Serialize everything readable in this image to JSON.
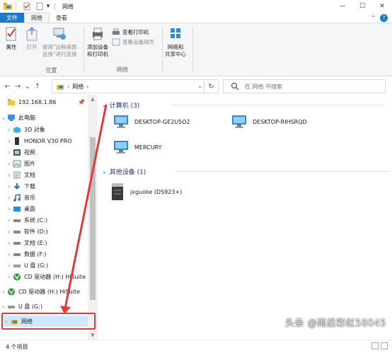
{
  "window": {
    "title": "网络",
    "controls": {
      "minimize": "—",
      "maximize": "☐",
      "close": "✕"
    }
  },
  "ribbon": {
    "tabs": [
      "文件",
      "网络",
      "查看"
    ],
    "groups": {
      "location": {
        "label": "位置",
        "buttons": [
          "属性",
          "打开",
          "使用\"远程桌面",
          "连接\"进行连接"
        ]
      },
      "network": {
        "label": "网络",
        "add_device": [
          "添加设备",
          "和打印机"
        ],
        "view_printers": "查看打印机",
        "view_device_page": "查看设备网页",
        "network_center": [
          "网络和",
          "共享中心"
        ]
      }
    }
  },
  "address": {
    "path": "网络",
    "search_placeholder": "在 网络 中搜索"
  },
  "nav": {
    "items": [
      {
        "label": "192.168.1.86",
        "icon": "folder-icon",
        "pinned": true
      },
      {
        "label": "此电脑",
        "icon": "computer-icon",
        "expanded": true
      },
      {
        "label": "3D 对象",
        "icon": "3d-objects-icon"
      },
      {
        "label": "HONOR V30 PRO",
        "icon": "phone-icon"
      },
      {
        "label": "视频",
        "icon": "video-icon"
      },
      {
        "label": "图片",
        "icon": "pictures-icon"
      },
      {
        "label": "文档",
        "icon": "documents-icon"
      },
      {
        "label": "下载",
        "icon": "download-icon"
      },
      {
        "label": "音乐",
        "icon": "music-icon"
      },
      {
        "label": "桌面",
        "icon": "desktop-icon"
      },
      {
        "label": "系统 (C:)",
        "icon": "drive-icon"
      },
      {
        "label": "软件 (D:)",
        "icon": "drive-icon"
      },
      {
        "label": "文档 (E:)",
        "icon": "drive-icon"
      },
      {
        "label": "数据 (F:)",
        "icon": "drive-icon"
      },
      {
        "label": "U 盘 (G:)",
        "icon": "usb-drive-icon"
      },
      {
        "label": "CD 驱动器 (H:) HiSuite",
        "icon": "cd-drive-icon"
      },
      {
        "label": "CD 驱动器 (H:) HiSuite",
        "icon": "cd-drive-icon"
      },
      {
        "label": "U 盘 (G:)",
        "icon": "usb-drive-icon"
      },
      {
        "label": "网络",
        "icon": "network-icon",
        "selected": true
      }
    ]
  },
  "content": {
    "sections": [
      {
        "title": "计算机 (3)"
      },
      {
        "title": "其他设备 (1)"
      }
    ],
    "computers": [
      "DESKTOP-GE2U5O2",
      "DESKTOP-RIHSRQD",
      "MERCURY"
    ],
    "other_devices": [
      "jxguoke (DS923+)"
    ]
  },
  "status": {
    "count": "4 个项目"
  },
  "watermark": "头条 @雨后彩虹58045",
  "colors": {
    "accent": "#1979ca",
    "selection": "#cce8ff",
    "annotation": "#e23a36",
    "section_title": "#1e3287"
  }
}
